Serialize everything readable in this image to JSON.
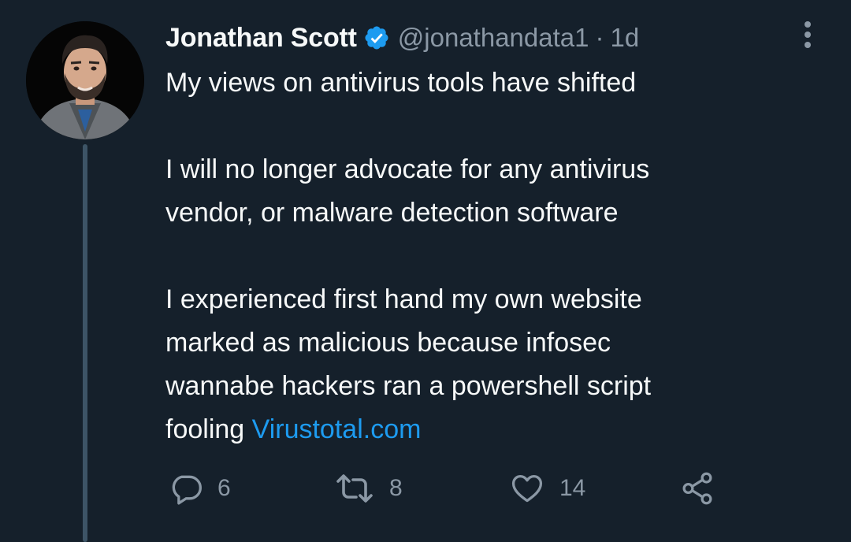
{
  "tweet": {
    "display_name": "Jonathan Scott",
    "handle": "@jonathandata1",
    "separator": "·",
    "time": "1d",
    "lines": [
      "My views on antivirus tools have shifted",
      "",
      "I will no longer advocate for any antivirus",
      "vendor, or malware detection software",
      "",
      "I experienced first hand my own website",
      "marked as malicious because infosec",
      "wannabe hackers ran a powershell script"
    ],
    "last_line_prefix": "fooling ",
    "link_text": "Virustotal.com"
  },
  "actions": {
    "reply_count": "6",
    "retweet_count": "8",
    "like_count": "14"
  },
  "colors": {
    "background": "#15202b",
    "text": "#f7f9f9",
    "secondary": "#8b98a5",
    "link": "#1d9bf0",
    "verified": "#1d9bf0",
    "thread_line": "#3d5466"
  },
  "icons": {
    "verified": "verified-badge-icon",
    "more": "more-dots-icon",
    "reply": "reply-icon",
    "retweet": "retweet-icon",
    "like": "heart-icon",
    "share": "share-icon"
  }
}
